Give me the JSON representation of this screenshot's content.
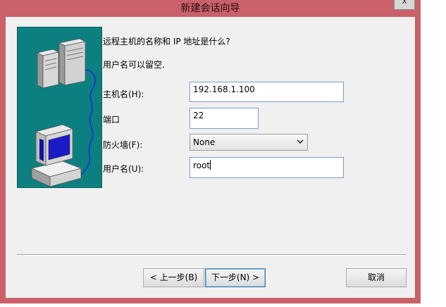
{
  "window": {
    "title": "新建会话向导",
    "close_glyph": "x"
  },
  "prompt": "远程主机的名称和 IP 地址是什么?",
  "hint": "用户名可以留空.",
  "fields": {
    "host_label": "主机名(H):",
    "host_value": "192.168.1.100",
    "port_label": "端口",
    "port_value": "22",
    "firewall_label": "防火墙(F):",
    "firewall_value": "None",
    "user_label": "用户名(U):",
    "user_value": "root"
  },
  "buttons": {
    "back": "< 上一步(B)",
    "next": "下一步(N) >",
    "cancel": "取消"
  },
  "colors": {
    "window_frame": "#c9606a",
    "illustration_bg": "#0c8080",
    "textbox_border": "#7a9cc6"
  },
  "icons": [
    "server-icon",
    "computer-icon",
    "cable-icon",
    "dropdown-arrow-icon",
    "close-icon"
  ]
}
